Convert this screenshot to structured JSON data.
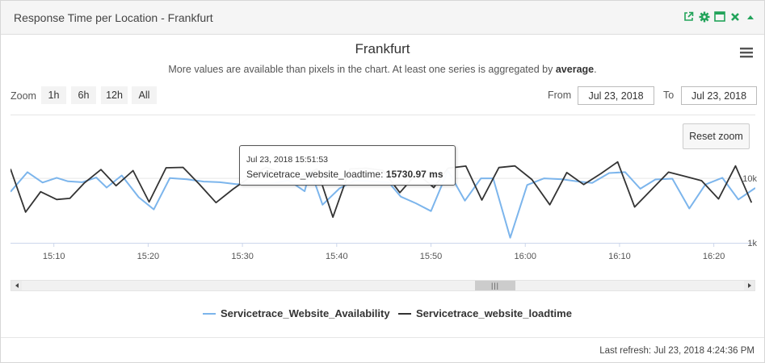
{
  "panel": {
    "title": "Response Time per Location - Frankfurt",
    "icons": [
      "external-link-icon",
      "gear-icon",
      "maximize-icon",
      "close-icon",
      "collapse-icon"
    ],
    "icon_color": "#22a35a"
  },
  "chart": {
    "title": "Frankfurt",
    "subtitle_text": "More values are available than pixels in the chart. At least one series is aggregated by ",
    "subtitle_bold": "average",
    "subtitle_end": "."
  },
  "zoom": {
    "label": "Zoom",
    "buttons": [
      "1h",
      "6h",
      "12h",
      "All"
    ]
  },
  "range": {
    "from_label": "From",
    "from_value": "Jul 23, 2018",
    "to_label": "To",
    "to_value": "Jul 23, 2018"
  },
  "reset_zoom_label": "Reset zoom",
  "tooltip": {
    "time": "Jul 23, 2018 15:51:53",
    "series_label": "Servicetrace_website_loadtime:",
    "value": "15730.97 ms"
  },
  "legend": [
    {
      "name": "Servicetrace_Website_Availability",
      "color": "#7cb5ec"
    },
    {
      "name": "Servicetrace_website_loadtime",
      "color": "#333333"
    }
  ],
  "footer": {
    "last_refresh": "Last refresh: Jul 23, 2018 4:24:36 PM"
  },
  "chart_data": {
    "type": "line",
    "x_unit": "minutes",
    "xlim": [
      5.4,
      28.7
    ],
    "x_ticks": [
      10,
      20,
      30,
      40,
      50,
      60,
      70,
      80
    ],
    "x_tick_labels": [
      "15:10",
      "15:20",
      "15:30",
      "15:40",
      "15:50",
      "16:00",
      "16:10",
      "16:20"
    ],
    "y_scale": "log",
    "ylim": [
      1000,
      40000
    ],
    "y_ticks": [
      1000,
      10000
    ],
    "y_tick_labels": [
      "1k",
      "10k"
    ],
    "series": [
      {
        "name": "Servicetrace_Website_Availability",
        "color": "#7cb5ec",
        "x": [
          5.4,
          7.2,
          8.8,
          10.3,
          11.5,
          13.0,
          14.5,
          15.6,
          17.2,
          19.0,
          20.6,
          22.3,
          24.1,
          25.9,
          27.6,
          29.4,
          31.2,
          33.0,
          34.9,
          36.6,
          37.2,
          38.5,
          40.3,
          41.9,
          43.7,
          45.5,
          46.8,
          48.4,
          50.0,
          51.8,
          53.6,
          55.3,
          56.6,
          58.4,
          60.2,
          62.0,
          63.9,
          65.7,
          67.1,
          68.9,
          70.6,
          72.2,
          73.8,
          75.6,
          77.4,
          79.1,
          80.9,
          82.6,
          84.4
        ],
        "y": [
          6200,
          12500,
          8600,
          10200,
          9000,
          8700,
          10300,
          7200,
          11100,
          5100,
          3300,
          10100,
          9700,
          8900,
          8700,
          8100,
          8400,
          8300,
          9300,
          6300,
          13500,
          3900,
          7000,
          9200,
          9000,
          8700,
          5200,
          4100,
          3100,
          13200,
          4500,
          10000,
          10000,
          1200,
          7900,
          10000,
          9700,
          8900,
          8500,
          12100,
          12500,
          6900,
          9600,
          9900,
          3400,
          8000,
          10200,
          4700,
          7100
        ]
      },
      {
        "name": "Servicetrace_website_loadtime",
        "color": "#333333",
        "x": [
          5.4,
          7.0,
          8.6,
          10.3,
          11.7,
          13.2,
          15.0,
          16.6,
          18.4,
          20.1,
          21.9,
          23.7,
          25.4,
          27.2,
          29.0,
          30.8,
          32.5,
          34.3,
          36.1,
          37.9,
          39.6,
          41.4,
          43.1,
          44.9,
          46.7,
          48.5,
          50.3,
          51.8,
          53.7,
          55.4,
          57.2,
          58.9,
          60.7,
          62.6,
          64.4,
          66.2,
          68.0,
          69.8,
          71.6,
          73.4,
          75.2,
          77.0,
          78.7,
          80.5,
          82.3,
          84.0
        ],
        "y": [
          14000,
          3000,
          6200,
          4700,
          4900,
          8400,
          13700,
          7700,
          13200,
          4300,
          14600,
          14800,
          8200,
          4200,
          6800,
          10400,
          14800,
          12000,
          10100,
          14000,
          2500,
          14000,
          14400,
          13300,
          6000,
          12000,
          7200,
          14400,
          15500,
          4600,
          14700,
          15600,
          9600,
          3900,
          12300,
          8000,
          11800,
          18000,
          3600,
          6700,
          12500,
          10700,
          9200,
          4800,
          15600,
          4200
        ]
      }
    ]
  }
}
